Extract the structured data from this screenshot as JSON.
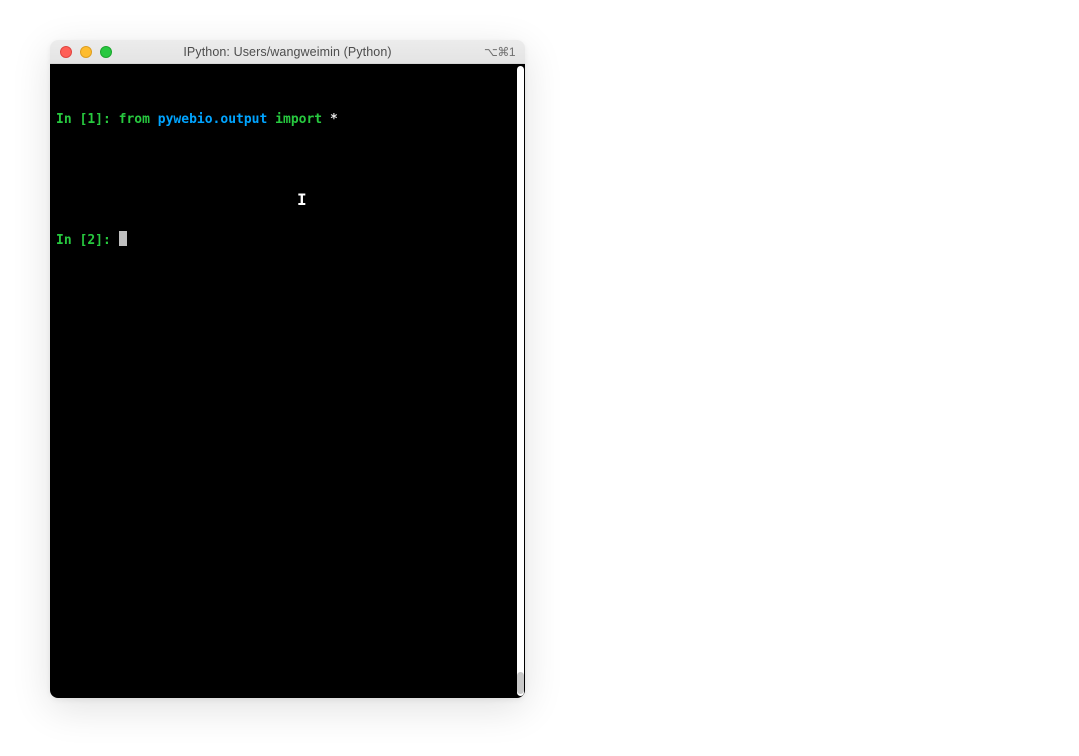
{
  "window": {
    "title": "IPython: Users/wangweimin (Python)",
    "shortcut": "⌥⌘1"
  },
  "terminal": {
    "lines": [
      {
        "prompt_prefix": "In [",
        "prompt_num": "1",
        "prompt_suffix": "]: ",
        "kw_from": "from",
        "module": "pywebio.output",
        "kw_import": "import",
        "star": "*"
      },
      {
        "prompt_prefix": "In [",
        "prompt_num": "2",
        "prompt_suffix": "]: ",
        "has_cursor": true
      }
    ]
  },
  "cursor_glyph": "I"
}
